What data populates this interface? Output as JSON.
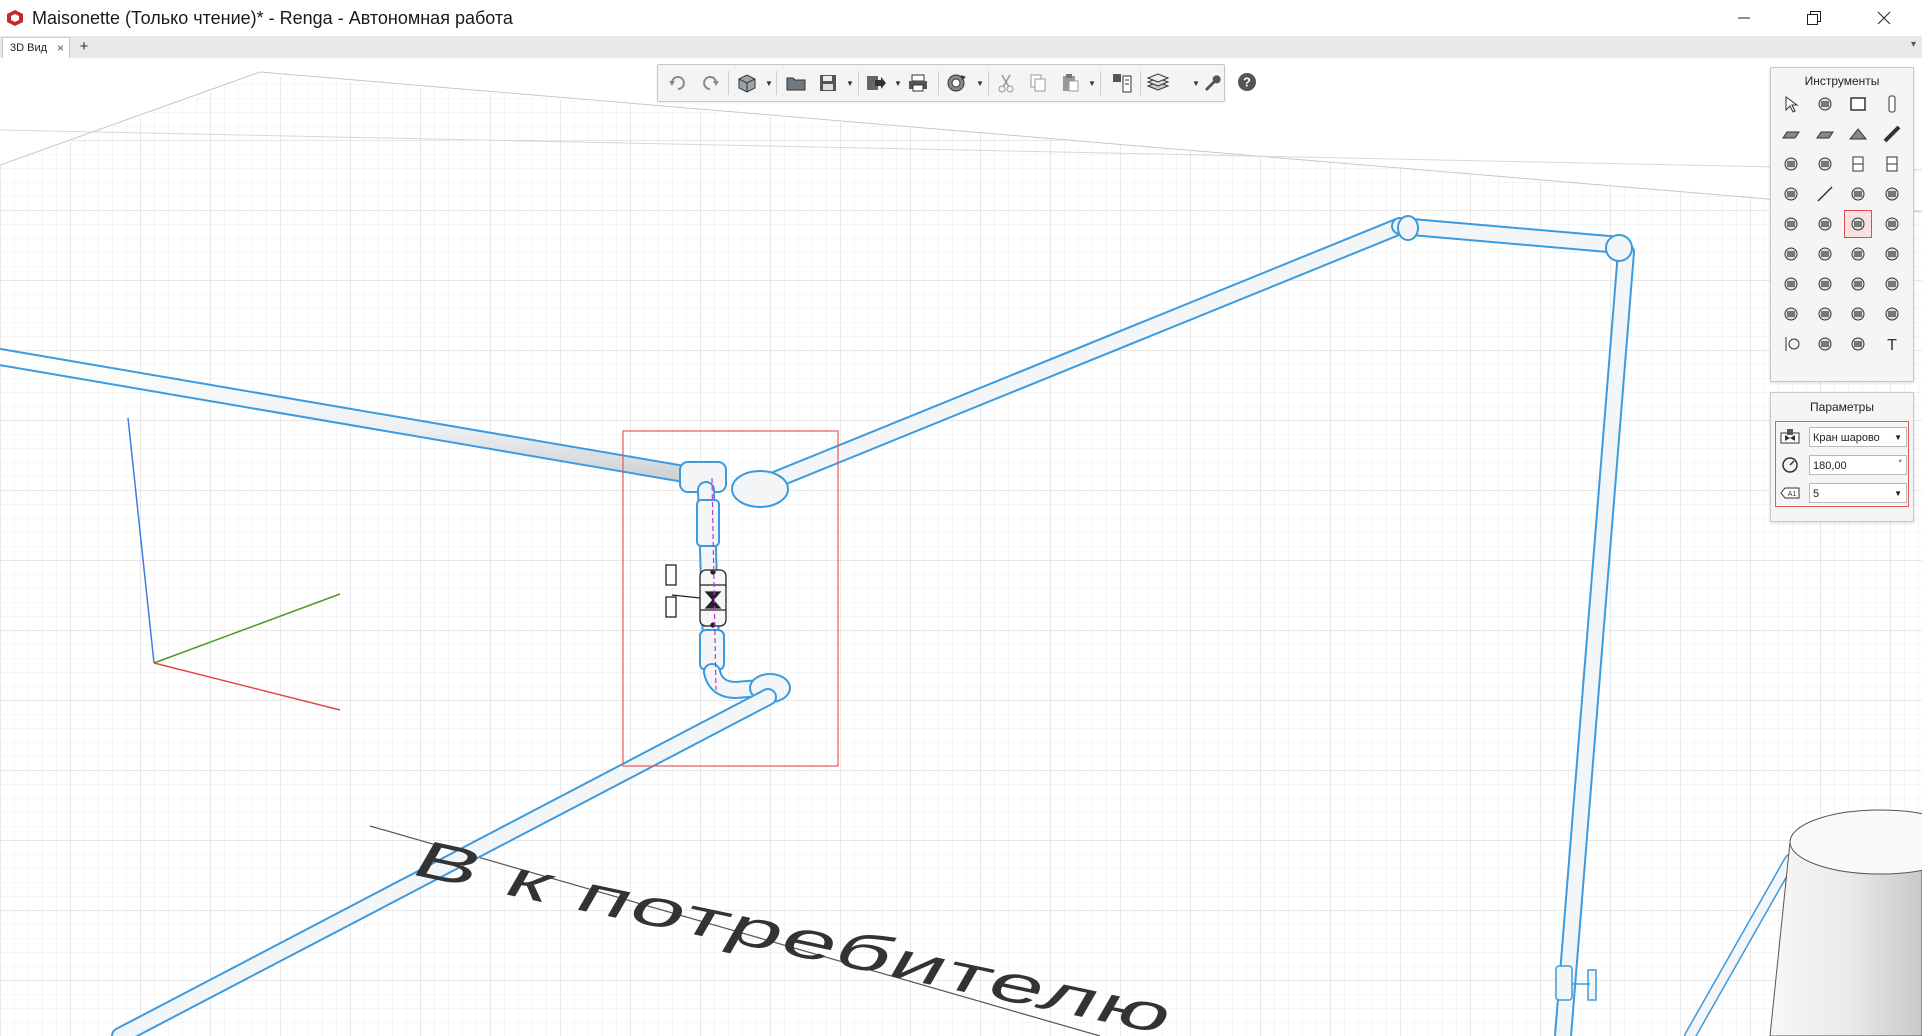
{
  "window": {
    "title": "Maisonette (Только чтение)* - Renga - Автономная работа",
    "controls": [
      "minimize-icon",
      "restore-icon",
      "close-icon"
    ]
  },
  "tabs": {
    "items": [
      {
        "label": "3D Вид",
        "close": "×"
      }
    ],
    "add_label": "+",
    "more_label": "▾"
  },
  "toolbar": {
    "buttons": [
      "undo-icon",
      "redo-icon",
      "view-cube-icon",
      "open-folder-icon",
      "save-icon",
      "export-icon",
      "print-icon",
      "sync-icon",
      "cut-icon",
      "copy-icon",
      "paste-icon",
      "layout-icon",
      "levels-icon",
      "wrench-icon",
      "help-icon"
    ]
  },
  "tools_panel": {
    "title": "Инструменты",
    "active_tool": "ball-valve-tool"
  },
  "params_panel": {
    "title": "Параметры",
    "type_value": "Кран шарово",
    "angle_value": "180,00",
    "angle_unit": "°",
    "level_value": "5"
  },
  "scene": {
    "floor_text": "В  к потребителю",
    "pipe_color": "#3b9be0",
    "selection_color": "#e35a5a"
  }
}
